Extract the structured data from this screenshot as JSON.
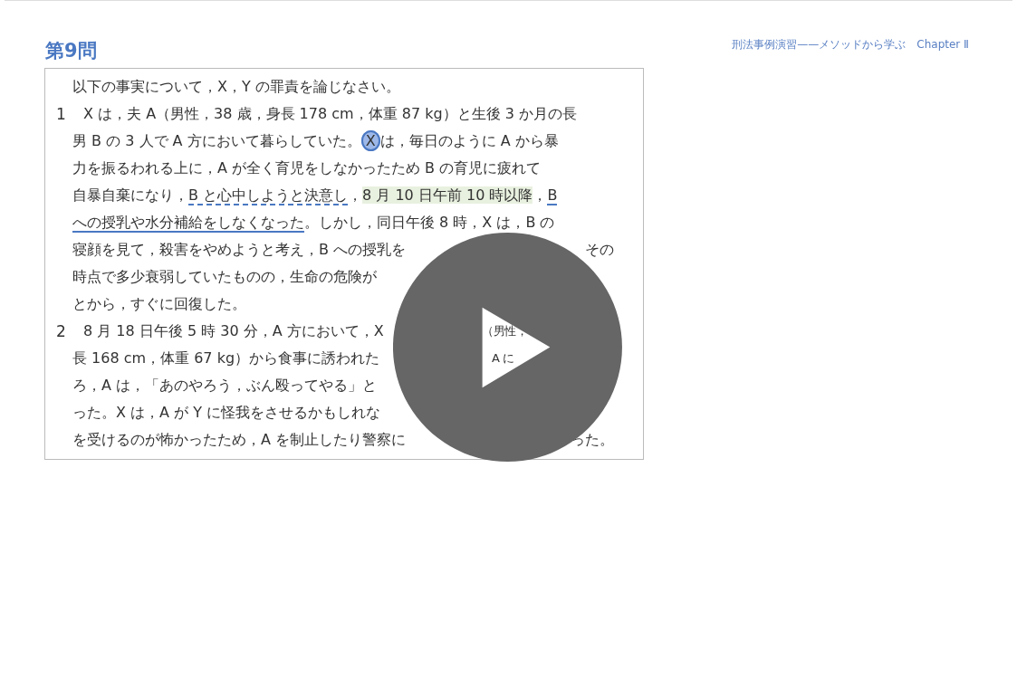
{
  "title": "第9問",
  "header": "刑法事例演習——メソッドから学ぶ　Chapter Ⅱ",
  "document": {
    "lines": [
      {
        "segments": [
          {
            "kind": "plain",
            "text": "以下の事実について，X，Y の罪責を論じなさい。"
          }
        ]
      },
      {
        "number": "1",
        "segments": [
          {
            "kind": "plain",
            "text": "X は，夫 A（男性，38 歳，身長 178 cm，体重 87 kg）と生後 3 か月の長"
          }
        ]
      },
      {
        "segments": [
          {
            "kind": "plain",
            "text": "男 B の 3 人で A 方において暮らしていた。"
          },
          {
            "kind": "circled",
            "text": "X"
          },
          {
            "kind": "plain",
            "text": "は，毎日のように A から暴"
          }
        ]
      },
      {
        "segments": [
          {
            "kind": "plain",
            "text": "力を振るわれる上に，A が全く育児をしなかったため B の育児に疲れて"
          }
        ]
      },
      {
        "segments": [
          {
            "kind": "plain",
            "text": "自暴自棄になり，"
          },
          {
            "kind": "dashed",
            "text": "B と心中しようと決意し"
          },
          {
            "kind": "plain",
            "text": "，"
          },
          {
            "kind": "highlight",
            "text": "8 月 10 日午前 10 時以降"
          },
          {
            "kind": "plain",
            "text": "，"
          },
          {
            "kind": "underline",
            "text": "B"
          }
        ]
      },
      {
        "segments": [
          {
            "kind": "underline",
            "text": "への授乳や水分補給をしなくなった"
          },
          {
            "kind": "plain",
            "text": "。しかし，同日午後 8 時，X は，B の"
          }
        ]
      },
      {
        "segments": [
          {
            "kind": "plain",
            "text": "寝顔を見て，殺害をやめようと考え，B への授乳を"
          }
        ],
        "right": "その"
      },
      {
        "segments": [
          {
            "kind": "plain",
            "text": "時点で多少衰弱していたものの，生命の危険が"
          }
        ]
      },
      {
        "segments": [
          {
            "kind": "plain",
            "text": "とから，すぐに回復した。"
          }
        ]
      },
      {
        "number": "2",
        "segments": [
          {
            "kind": "plain",
            "text": "8 月 18 日午後 5 時 30 分，A 方において，X"
          }
        ],
        "through_button": "（男性，"
      },
      {
        "segments": [
          {
            "kind": "plain",
            "text": "長 168 cm，体重 67 kg）から食事に誘われた"
          }
        ],
        "through_button": "A に"
      },
      {
        "segments": [
          {
            "kind": "plain",
            "text": "ろ，A は，「あのやろう，ぶん殴ってやる」と"
          }
        ]
      },
      {
        "segments": [
          {
            "kind": "plain",
            "text": "った。X は，A が Y に怪我をさせるかもしれな"
          }
        ]
      },
      {
        "segments": [
          {
            "kind": "plain",
            "text": "を受けるのが怖かったため，A を制止したり警察に"
          }
        ],
        "right": "った。"
      }
    ]
  }
}
